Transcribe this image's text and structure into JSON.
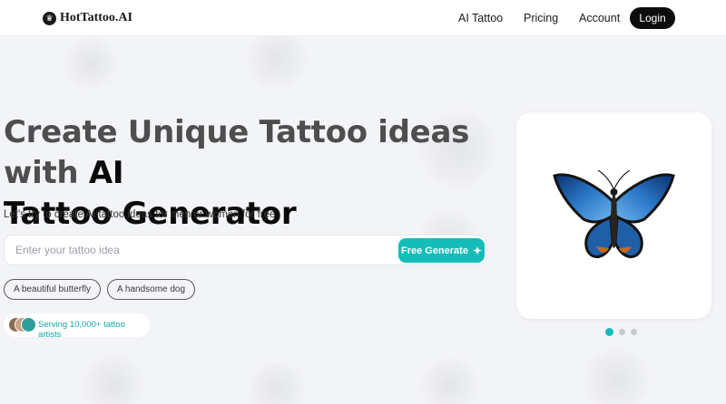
{
  "header": {
    "brand": "HotTattoo.AI",
    "nav": [
      "AI Tattoo",
      "Pricing",
      "Account"
    ],
    "login_label": "Login"
  },
  "hero": {
    "title_part1": "Create Unique Tattoo ideas with ",
    "title_highlight": "AI",
    "title_part2": "Tattoo Generator",
    "subtitle": "Let's try to create AI tattoo ideas for men or women for free"
  },
  "search": {
    "placeholder": "Enter your tattoo idea",
    "value": "",
    "button_label": "Free Generate"
  },
  "suggestions": [
    "A beautiful butterfly",
    "A handsome dog"
  ],
  "social_proof": {
    "text": "Serving 10,000+ tattoo artists"
  },
  "carousel": {
    "slide_count": 3,
    "active_index": 0,
    "image_subject": "blue butterfly tattoo"
  },
  "colors": {
    "accent": "#14bdb8",
    "dark": "#0d0d0d",
    "background": "#f3f4f7"
  }
}
